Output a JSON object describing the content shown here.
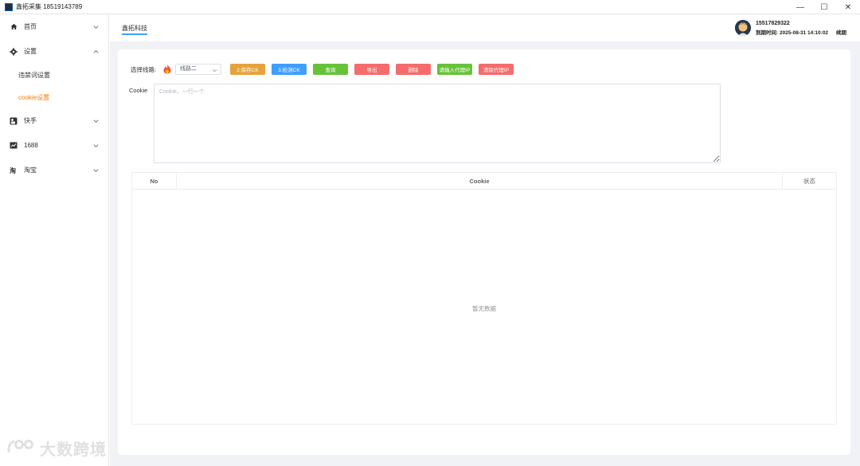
{
  "window": {
    "title": "鑫拓采集 18519143789",
    "controls": {
      "minimize": "—",
      "maximize": "☐",
      "close": "✕"
    }
  },
  "sidebar": {
    "items": [
      {
        "label": "首页",
        "icon": "home-icon",
        "expanded": false
      },
      {
        "label": "设置",
        "icon": "gear-icon",
        "expanded": true,
        "children": [
          {
            "label": "违禁词设置",
            "active": false
          },
          {
            "label": "cookie设置",
            "active": true
          }
        ]
      },
      {
        "label": "快手",
        "icon": "kuaishou-icon",
        "expanded": false
      },
      {
        "label": "1688",
        "icon": "chart-icon",
        "expanded": false
      },
      {
        "label": "淘宝",
        "icon": "taobao-icon",
        "expanded": false
      }
    ],
    "active_color": "#f57c00"
  },
  "header": {
    "tab": "鑫拓科技",
    "user": {
      "phone": "15517829322",
      "expire": "到期时间: 2025-08-31 14:10:02",
      "renew": "续期"
    }
  },
  "toolbar": {
    "line_label": "选择线路:",
    "line_value": "线路二",
    "buttons": [
      {
        "label": "2.保存CK",
        "color": "#e6a23c"
      },
      {
        "label": "3.检测CK",
        "color": "#409eff"
      },
      {
        "label": "查询",
        "color": "#67c23a"
      },
      {
        "label": "导出",
        "color": "#f56c6c"
      },
      {
        "label": "删除",
        "color": "#f56c6c"
      },
      {
        "label": "请输入代理IP",
        "color": "#67c23a"
      },
      {
        "label": "清除代理IP",
        "color": "#f56c6c"
      }
    ]
  },
  "cookie": {
    "label": "Cookie",
    "placeholder": "Cookie，一行一个",
    "value": ""
  },
  "table": {
    "columns": [
      "No",
      "Cookie",
      "状态"
    ],
    "empty_text": "暂无数据"
  },
  "watermark": "大数跨境"
}
